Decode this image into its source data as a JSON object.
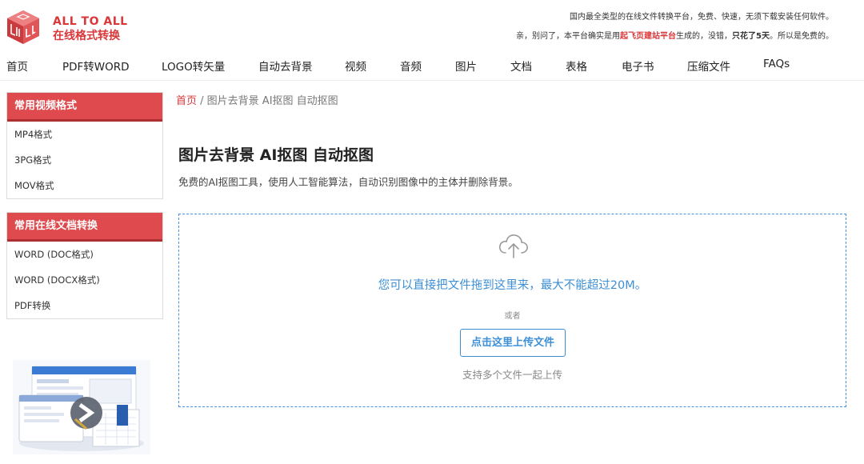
{
  "header": {
    "brand_en": "ALL TO ALL",
    "brand_cn": "在线格式转换",
    "notice_line1": "国内最全类型的在线文件转换平台，免费、快速，无须下载安装任何软件。",
    "notice_line2_a": "亲，别问了，本平台确实是用",
    "notice_line2_link": "起飞页建站平台",
    "notice_line2_b": "生成的，没错，",
    "notice_line2_bold": "只花了5天",
    "notice_line2_c": "。所以是免费的。",
    "accent_color": "#d9373a"
  },
  "nav": [
    "首页",
    "PDF转WORD",
    "LOGO转矢量",
    "自动去背景",
    "视频",
    "音频",
    "图片",
    "文档",
    "表格",
    "电子书",
    "压缩文件",
    "FAQs"
  ],
  "sidebar": {
    "video_box": {
      "title": "常用视频格式",
      "items": [
        "MP4格式",
        "3PG格式",
        "MOV格式"
      ]
    },
    "doc_box": {
      "title": "常用在线文档转换",
      "items": [
        "WORD (DOC格式)",
        "WORD (DOCX格式)",
        "PDF转换"
      ]
    }
  },
  "breadcrumb": {
    "home": "首页",
    "separator": " / ",
    "current": "图片去背景 AI抠图 自动抠图"
  },
  "main": {
    "title": "图片去背景 AI抠图 自动抠图",
    "description": "免费的AI抠图工具，使用人工智能算法，自动识别图像中的主体并删除背景。"
  },
  "upload": {
    "drop_text": "您可以直接把文件拖到这里来，最大不能超过20M。",
    "or_text": "或者",
    "button_label": "点击这里上传文件",
    "multi_text": "支持多个文件一起上传",
    "icon": "cloud-upload-icon",
    "accent_color": "#3d8fd6"
  }
}
